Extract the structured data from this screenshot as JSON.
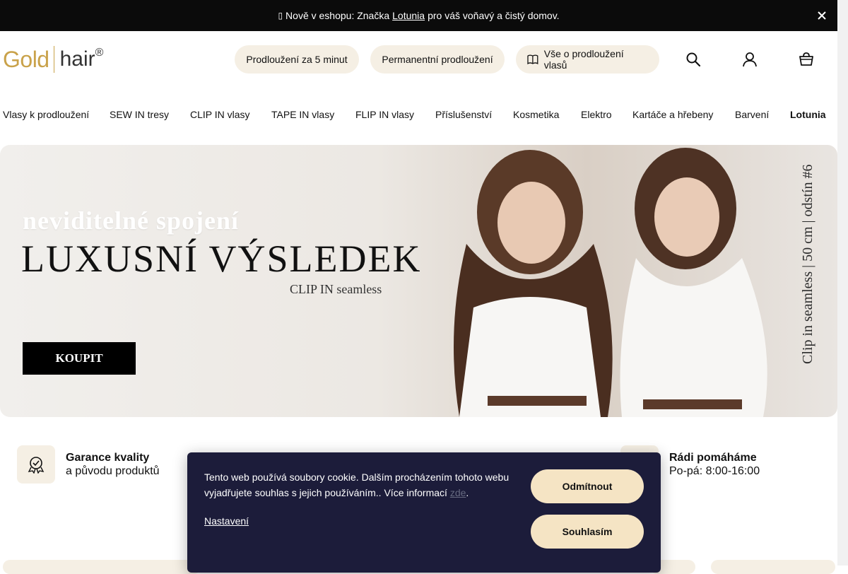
{
  "announcement": {
    "prefix": "Nově v eshopu: Značka",
    "link": "Lotunia",
    "suffix": "pro váš voňavý a čistý domov.",
    "bullet_icon": "dot-icon"
  },
  "logo": {
    "gold": "Gold",
    "hair": "hair",
    "reg": "®"
  },
  "header_pills": [
    {
      "label": "Prodloužení za 5 minut"
    },
    {
      "label": "Permanentní prodloužení"
    },
    {
      "label": "Vše o prodloužení vlasů",
      "icon": "book-icon"
    }
  ],
  "header_icons": [
    "search-icon",
    "user-icon",
    "cart-icon"
  ],
  "nav": {
    "items": [
      "Vlasy k prodloužení",
      "SEW IN tresy",
      "CLIP IN vlasy",
      "TAPE IN vlasy",
      "FLIP IN vlasy",
      "Příslušenství",
      "Kosmetika",
      "Elektro",
      "Kartáče a hřebeny",
      "Barvení",
      "Lotunia"
    ]
  },
  "hero": {
    "script": "neviditelné spojení",
    "headline": "LUXUSNÍ VÝSLEDEK",
    "sub": "CLIP IN seamless",
    "button": "KOUPIT",
    "vertical": "Clip in seamless | 50 cm | odstín #6"
  },
  "features": [
    {
      "title": "Garance kvality",
      "text": "a původu produktů",
      "icon": "quality-badge-icon"
    },
    {
      "title": "Rádi pomáháme",
      "text": "Po-pá: 8:00-16:00",
      "icon": "support-icon"
    }
  ],
  "cookie": {
    "text": "Tento web používá soubory cookie. Dalším procházením tohoto webu vyjadřujete souhlas s jejich používáním.. Více informací",
    "more_link": "zde",
    "period": ".",
    "settings": "Nastavení",
    "decline": "Odmítnout",
    "accept": "Souhlasím"
  },
  "colors": {
    "accent": "#f5efe4",
    "gold": "#c9a24a",
    "dialog": "#1c1c3a",
    "button": "#f5e4c4"
  }
}
